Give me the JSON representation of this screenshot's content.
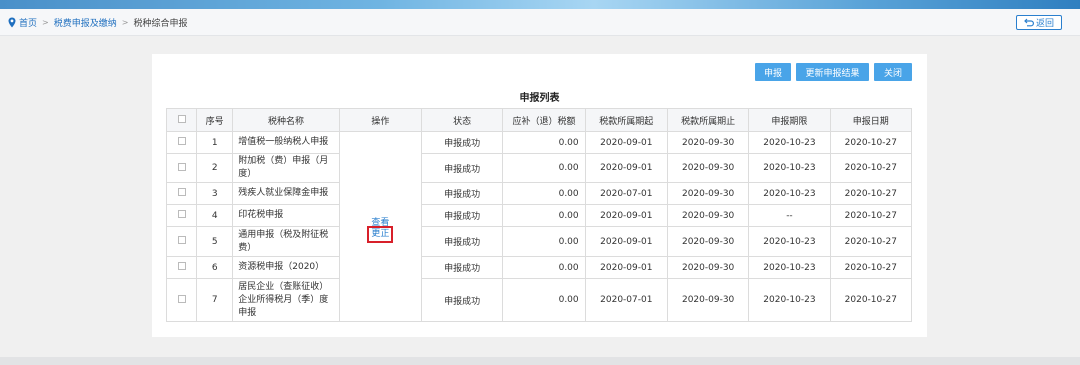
{
  "breadcrumb": {
    "home": "首页",
    "level1": "税费申报及缴纳",
    "current": "税种综合申报",
    "separator": ">"
  },
  "back_button": {
    "label": "返回"
  },
  "actions": {
    "declare": "申报",
    "refresh": "更新申报结果",
    "close": "关闭"
  },
  "table": {
    "title": "申报列表",
    "headers": {
      "seq": "序号",
      "name": "税种名称",
      "op": "操作",
      "status": "状态",
      "amount": "应补（退）税额",
      "start": "税款所属期起",
      "end": "税款所属期止",
      "deadline": "申报期限",
      "date": "申报日期"
    },
    "op_view": "查看",
    "op_correct": "更正",
    "rows": [
      {
        "seq": "1",
        "name": "增值税一般纳税人申报",
        "status": "申报成功",
        "amount": "0.00",
        "start": "2020-09-01",
        "end": "2020-09-30",
        "deadline": "2020-10-23",
        "date": "2020-10-27"
      },
      {
        "seq": "2",
        "name": "附加税（费）申报（月度）",
        "status": "申报成功",
        "amount": "0.00",
        "start": "2020-09-01",
        "end": "2020-09-30",
        "deadline": "2020-10-23",
        "date": "2020-10-27"
      },
      {
        "seq": "3",
        "name": "残疾人就业保障金申报",
        "status": "申报成功",
        "amount": "0.00",
        "start": "2020-07-01",
        "end": "2020-09-30",
        "deadline": "2020-10-23",
        "date": "2020-10-27"
      },
      {
        "seq": "4",
        "name": "印花税申报",
        "status": "申报成功",
        "amount": "0.00",
        "start": "2020-09-01",
        "end": "2020-09-30",
        "deadline": "--",
        "date": "2020-10-27"
      },
      {
        "seq": "5",
        "name": "通用申报（税及附征税费）",
        "status": "申报成功",
        "amount": "0.00",
        "start": "2020-09-01",
        "end": "2020-09-30",
        "deadline": "2020-10-23",
        "date": "2020-10-27"
      },
      {
        "seq": "6",
        "name": "资源税申报（2020）",
        "status": "申报成功",
        "amount": "0.00",
        "start": "2020-09-01",
        "end": "2020-09-30",
        "deadline": "2020-10-23",
        "date": "2020-10-27"
      },
      {
        "seq": "7",
        "name": "居民企业（查账征收）企业所得税月（季）度申报",
        "status": "申报成功",
        "amount": "0.00",
        "start": "2020-07-01",
        "end": "2020-09-30",
        "deadline": "2020-10-23",
        "date": "2020-10-27"
      }
    ]
  },
  "colors": {
    "link": "#1f6fbf",
    "button": "#49a4e8",
    "highlight_border": "#d8202a"
  }
}
